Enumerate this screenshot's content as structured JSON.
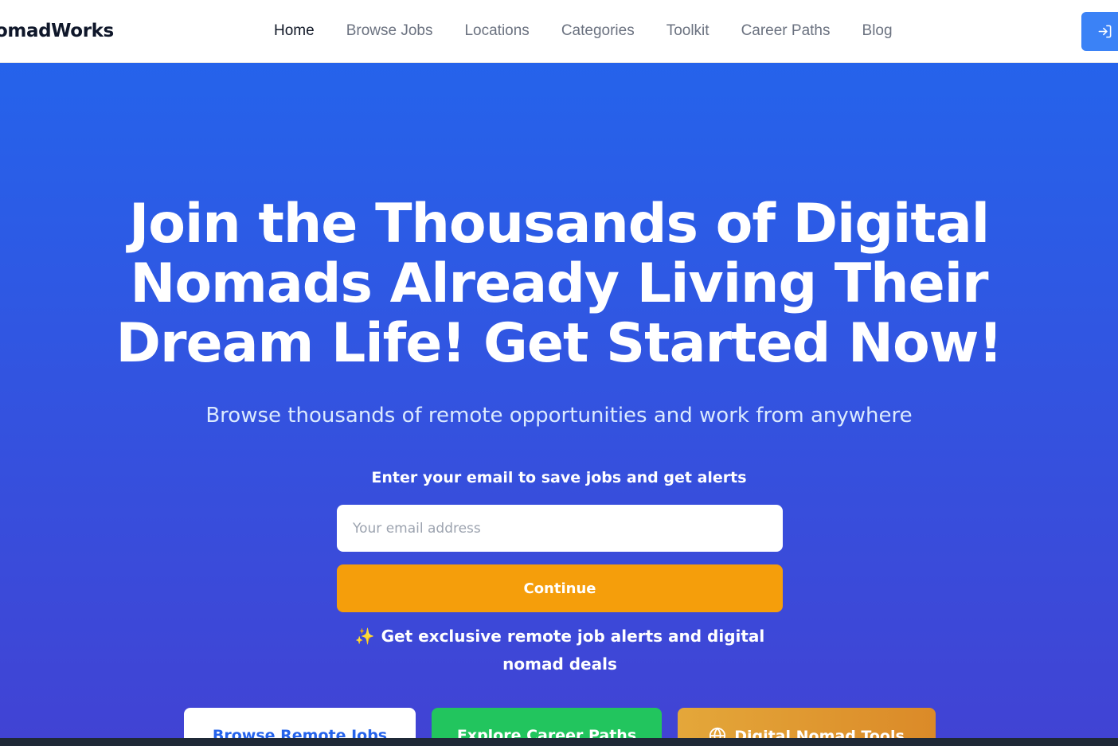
{
  "brand": {
    "name": "omadWorks"
  },
  "nav": {
    "items": [
      {
        "label": "Home",
        "active": true
      },
      {
        "label": "Browse Jobs",
        "active": false
      },
      {
        "label": "Locations",
        "active": false
      },
      {
        "label": "Categories",
        "active": false
      },
      {
        "label": "Toolkit",
        "active": false
      },
      {
        "label": "Career Paths",
        "active": false
      },
      {
        "label": "Blog",
        "active": false
      }
    ],
    "login_icon": "login-arrow-icon"
  },
  "hero": {
    "headline_lines": [
      "Join the Thousands of Digital",
      "Nomads Already Living Their",
      "Dream Life! Get Started Now!"
    ],
    "subheadline": "Browse thousands of remote opportunities and work from anywhere",
    "signup": {
      "label": "Enter your email to save jobs and get alerts",
      "placeholder": "Your email address",
      "value": "",
      "button_label": "Continue",
      "perk_icon": "✨",
      "perk_text": "Get exclusive remote job alerts and digital nomad deals"
    },
    "ctas": [
      {
        "label": "Browse Remote Jobs"
      },
      {
        "label": "Explore Career Paths"
      },
      {
        "label": "Digital Nomad Tools",
        "icon": "globe-icon"
      }
    ]
  },
  "colors": {
    "primary": "#2563eb",
    "gradient_end": "#4143d4",
    "accent_orange": "#f59e0b",
    "accent_green": "#22c55e",
    "login_button": "#3b82f6"
  }
}
